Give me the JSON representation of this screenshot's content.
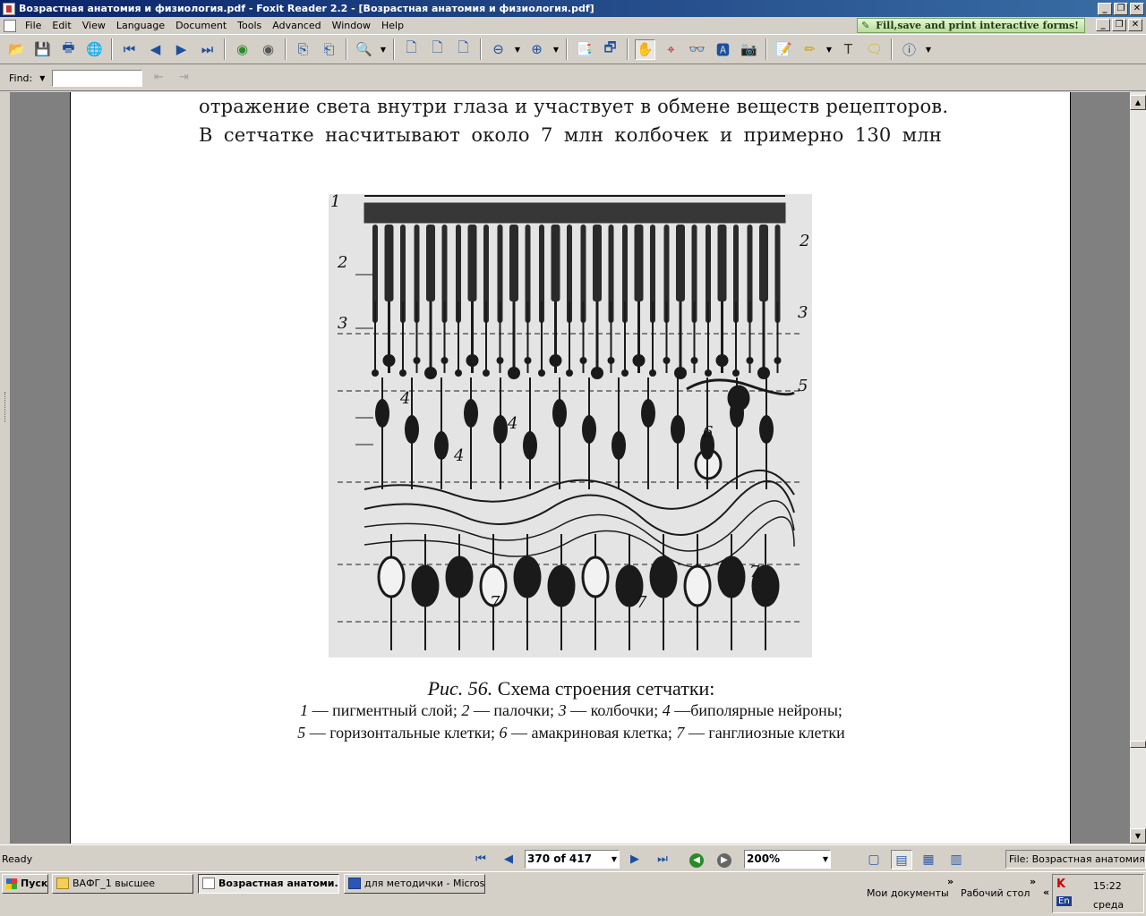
{
  "window": {
    "title": "Возрастная анатомия и физиология.pdf - Foxit Reader 2.2 - [Возрастная анатомия и физиология.pdf]"
  },
  "menu": {
    "items": [
      "File",
      "Edit",
      "View",
      "Language",
      "Document",
      "Tools",
      "Advanced",
      "Window",
      "Help"
    ],
    "promo": "Fill,save and print interactive forms!"
  },
  "findbar": {
    "label": "Find:",
    "value": ""
  },
  "document": {
    "line1": "отражение света внутри глаза и участвует в обмене веществ рецепторов.",
    "line2": "В сетчатке насчитывают около 7 млн колбочек и примерно 130 млн",
    "figure_labels": [
      "1",
      "2",
      "3",
      "2",
      "3",
      "4",
      "4",
      "4",
      "5",
      "6",
      "7",
      "7",
      "7"
    ],
    "caption_prefix": "Рис. 56.",
    "caption_title": " Схема строения сетчатки:",
    "legend_line1": [
      {
        "n": "1",
        "t": " — пигментный слой; "
      },
      {
        "n": "2",
        "t": " — палочки; "
      },
      {
        "n": "3",
        "t": " — колбочки; "
      },
      {
        "n": "4",
        "t": " —биполярные нейроны;"
      }
    ],
    "legend_line2": [
      {
        "n": "5",
        "t": " — горизонтальные клетки; "
      },
      {
        "n": "6",
        "t": " — амакриновая клетка; "
      },
      {
        "n": "7",
        "t": " — ганглиозные клетки"
      }
    ]
  },
  "statusbar": {
    "status": "Ready",
    "page": "370 of 417",
    "zoom": "200%",
    "file_info": "File: Возрастная анатомия и физиология.pdf"
  },
  "taskbar": {
    "start": "Пуск",
    "tasks": [
      "ВАФГ_1 высшее",
      "Возрастная анатоми...",
      "для методички - Micros..."
    ],
    "quick1": "Мои документы",
    "quick2": "Рабочий стол",
    "lang": "En",
    "time": "15:22",
    "day": "среда"
  }
}
